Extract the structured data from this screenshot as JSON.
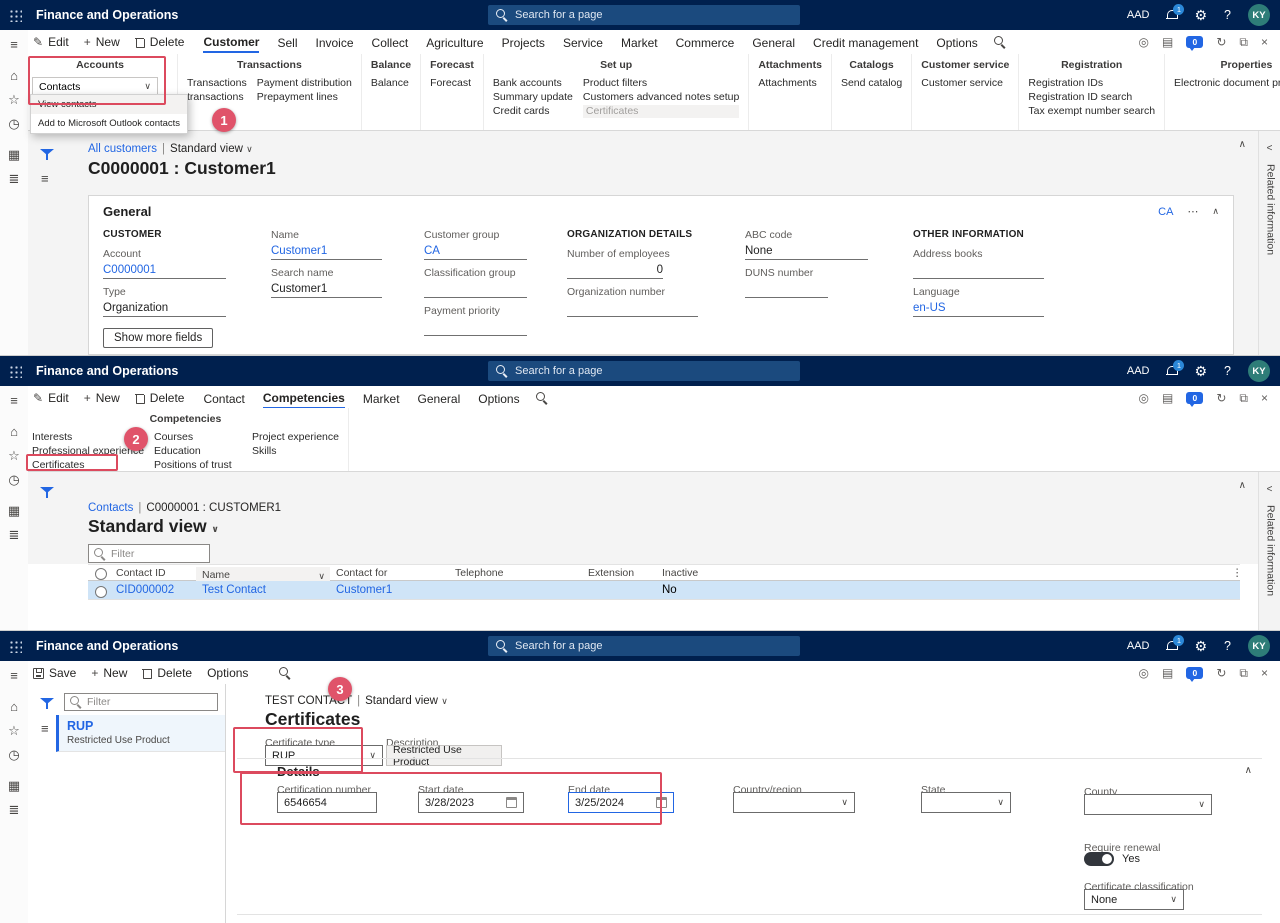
{
  "colors": {
    "header_bg": "#00204e",
    "accent_blue": "#2266e3",
    "annotation_red": "#dc4a5e",
    "selected_row_blue": "#cfe4f7",
    "avatar_teal": "#2e7d78",
    "toggle_on_dark": "#32363c"
  },
  "icons": {
    "chevron_down": "∨",
    "chevron_up": "∧",
    "chevron_left": "<",
    "ellipsis_v": "⋮",
    "ellipsis_h": "⋯",
    "pencil": "✎",
    "plus": "+",
    "gear": "⚙",
    "help": "?",
    "refresh": "↻",
    "expand": "⧉",
    "close": "×",
    "hamburger": "≡",
    "home": "⌂",
    "star": "☆",
    "clock": "◷",
    "grid": "▦",
    "list": "≣",
    "target": "◎",
    "pages": "▤"
  },
  "header": {
    "app_title": "Finance and Operations",
    "search_placeholder": "Search for a page",
    "aad_label": "AAD",
    "bell_badge": "1",
    "chat_badge": "0",
    "avatar_initials": "KY"
  },
  "annotations": {
    "step1": "1",
    "step2": "2",
    "step3": "3"
  },
  "p1": {
    "commands": [
      "Edit",
      "New",
      "Delete"
    ],
    "tabs": [
      "Customer",
      "Sell",
      "Invoice",
      "Collect",
      "Agriculture",
      "Projects",
      "Service",
      "Market",
      "Commerce",
      "General",
      "Credit management",
      "Options"
    ],
    "ribbon": {
      "g0": {
        "name": "Accounts",
        "button": "Contacts",
        "menu": [
          "View contacts",
          "Add to Microsoft Outlook contacts"
        ]
      },
      "g1": {
        "name": "Transactions",
        "c0": [
          "Transactions",
          "transactions"
        ],
        "c1": [
          "Payment distribution",
          "Prepayment lines"
        ]
      },
      "g2": {
        "name": "Balance",
        "c0": [
          "Balance"
        ]
      },
      "g3": {
        "name": "Forecast",
        "c0": [
          "Forecast"
        ]
      },
      "g4": {
        "name": "Set up",
        "c0": [
          "Bank accounts",
          "Summary update",
          "Credit cards"
        ],
        "c1": [
          "Product filters",
          "Customers advanced notes setup",
          "Certificates"
        ]
      },
      "g5": {
        "name": "Attachments",
        "c0": [
          "Attachments"
        ]
      },
      "g6": {
        "name": "Catalogs",
        "c0": [
          "Send catalog"
        ]
      },
      "g7": {
        "name": "Customer service",
        "c0": [
          "Customer service"
        ]
      },
      "g8": {
        "name": "Registration",
        "c0": [
          "Registration IDs",
          "Registration ID search",
          "Tax exempt number search"
        ]
      },
      "g9": {
        "name": "Properties",
        "c0": [
          "Electronic document properties"
        ]
      }
    },
    "crumb": {
      "link": "All customers",
      "sep": "|",
      "view": "Standard view"
    },
    "title": "C0000001 : Customer1",
    "general": {
      "title": "General",
      "summary": "CA",
      "c1_header": "CUSTOMER",
      "c1": [
        {
          "l": "Account",
          "v": "C0000001"
        },
        {
          "l": "Type",
          "v": "Organization"
        }
      ],
      "c2": [
        {
          "l": "Name",
          "v": "Customer1"
        },
        {
          "l": "Search name",
          "v": "Customer1"
        }
      ],
      "c3": [
        {
          "l": "Customer group",
          "v": "CA"
        },
        {
          "l": "Classification group",
          "v": ""
        },
        {
          "l": "Payment priority",
          "v": ""
        }
      ],
      "c4_header": "ORGANIZATION DETAILS",
      "c4": [
        {
          "l": "Number of employees",
          "v": "0"
        },
        {
          "l": "Organization number",
          "v": ""
        }
      ],
      "c5": [
        {
          "l": "ABC code",
          "v": "None"
        },
        {
          "l": "DUNS number",
          "v": ""
        }
      ],
      "c6_header": "OTHER INFORMATION",
      "c6": [
        {
          "l": "Address books",
          "v": ""
        },
        {
          "l": "Language",
          "v": "en-US"
        }
      ]
    },
    "show_more_button": "Show more fields",
    "related_info": "Related information"
  },
  "p2": {
    "commands": [
      "Edit",
      "New",
      "Delete"
    ],
    "tabs": [
      "Contact",
      "Competencies",
      "Market",
      "General",
      "Options"
    ],
    "ribbon": {
      "name": "Competencies",
      "c0": [
        "Interests",
        "Professional experience",
        "Certificates"
      ],
      "c1": [
        "Courses",
        "Education",
        "Positions of trust"
      ],
      "c2": [
        "Project experience",
        "Skills"
      ]
    },
    "crumb": {
      "link": "Contacts",
      "sep": "|",
      "record": "C0000001 : CUSTOMER1"
    },
    "view_title": "Standard view",
    "filter_placeholder": "Filter",
    "grid": {
      "columns": [
        "Contact ID",
        "Name",
        "Contact for",
        "Telephone",
        "Extension",
        "Inactive"
      ],
      "row": {
        "contact_id": "CID000002",
        "name": "Test Contact",
        "contact_for": "Customer1",
        "telephone": "",
        "extension": "",
        "inactive": "No"
      }
    },
    "related_info": "Related information"
  },
  "p3": {
    "commands": [
      "Save",
      "New",
      "Delete",
      "Options"
    ],
    "filter_placeholder": "Filter",
    "list_item": {
      "title": "RUP",
      "subtitle": "Restricted Use Product"
    },
    "crumb": {
      "record": "TEST CONTACT",
      "sep": "|",
      "view": "Standard view"
    },
    "title": "Certificates",
    "certificate_type": {
      "label": "Certificate type",
      "value": "RUP"
    },
    "description": {
      "label": "Description",
      "value": "Restricted Use Product"
    },
    "details": {
      "title": "Details",
      "certification_number": {
        "label": "Certification number",
        "value": "6546654"
      },
      "start_date": {
        "label": "Start date",
        "value": "3/28/2023"
      },
      "end_date": {
        "label": "End date",
        "value": "3/25/2024"
      },
      "country": {
        "label": "Country/region",
        "value": ""
      },
      "state": {
        "label": "State",
        "value": ""
      },
      "county": {
        "label": "County",
        "value": ""
      },
      "require_renewal": {
        "label": "Require renewal",
        "value": "Yes"
      },
      "certificate_classification": {
        "label": "Certificate classification",
        "value": "None"
      }
    }
  }
}
